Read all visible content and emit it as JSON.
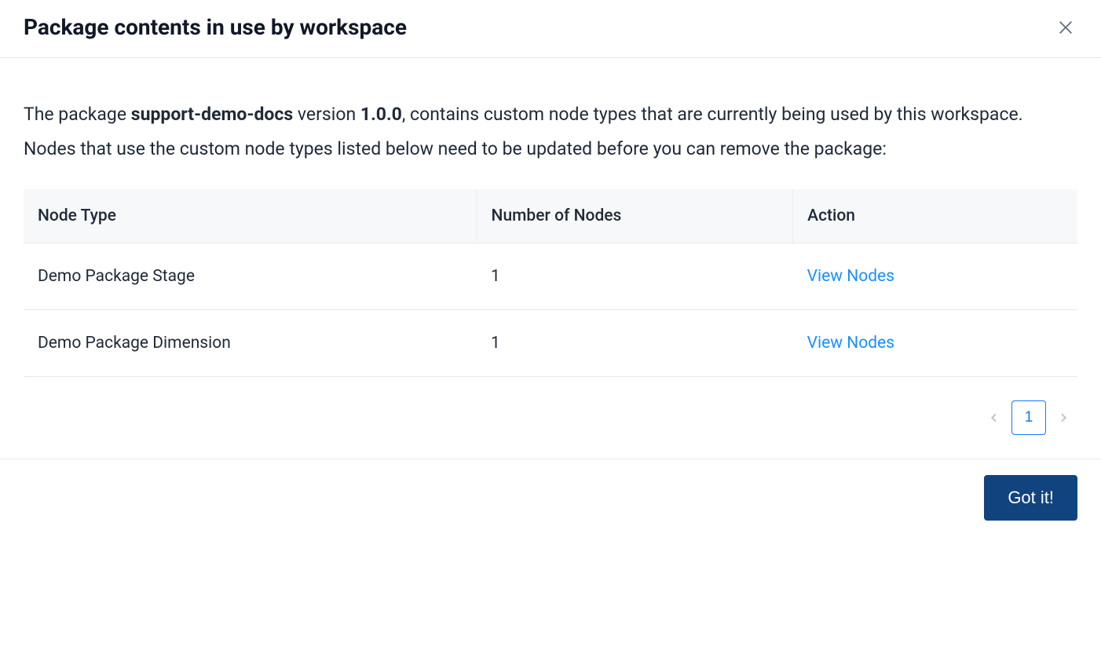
{
  "modal": {
    "title": "Package contents in use by workspace",
    "description": {
      "prefix": "The package ",
      "packageName": "support-demo-docs",
      "mid1": " version ",
      "version": "1.0.0",
      "suffix": ", contains custom node types that are currently being used by this workspace. Nodes that use the custom node types listed below need to be updated before you can remove the package:"
    },
    "table": {
      "columns": {
        "nodeType": "Node Type",
        "count": "Number of Nodes",
        "action": "Action"
      },
      "rows": [
        {
          "nodeType": "Demo Package Stage",
          "count": "1",
          "action": "View Nodes"
        },
        {
          "nodeType": "Demo Package Dimension",
          "count": "1",
          "action": "View Nodes"
        }
      ]
    },
    "pagination": {
      "current": "1"
    },
    "footer": {
      "confirm": "Got it!"
    }
  }
}
